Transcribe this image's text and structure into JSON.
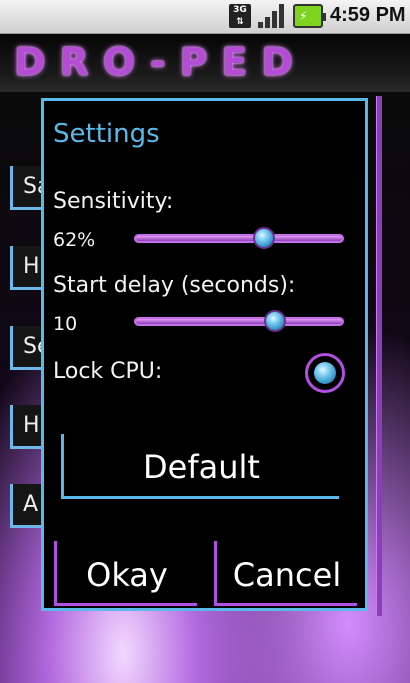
{
  "status_bar": {
    "network_label": "3G",
    "time": "4:59 PM",
    "icons": [
      "network-3g-icon",
      "signal-icon",
      "battery-charging-icon"
    ]
  },
  "app": {
    "title": "DRO-PED",
    "background_items": [
      {
        "label": "Sa"
      },
      {
        "label": "H"
      },
      {
        "label": "Se"
      },
      {
        "label": "H"
      },
      {
        "label": "A"
      }
    ]
  },
  "dialog": {
    "title": "Settings",
    "sensitivity": {
      "label": "Sensitivity:",
      "value": "62%",
      "level": 0.62
    },
    "start_delay": {
      "label": "Start delay (seconds):",
      "value": "10",
      "level": 0.67
    },
    "lock_cpu": {
      "label": "Lock CPU:",
      "checked": true
    },
    "default_button": "Default",
    "okay_button": "Okay",
    "cancel_button": "Cancel"
  },
  "colors": {
    "accent_blue": "#5ab9e8",
    "accent_purple": "#b04fe0"
  }
}
